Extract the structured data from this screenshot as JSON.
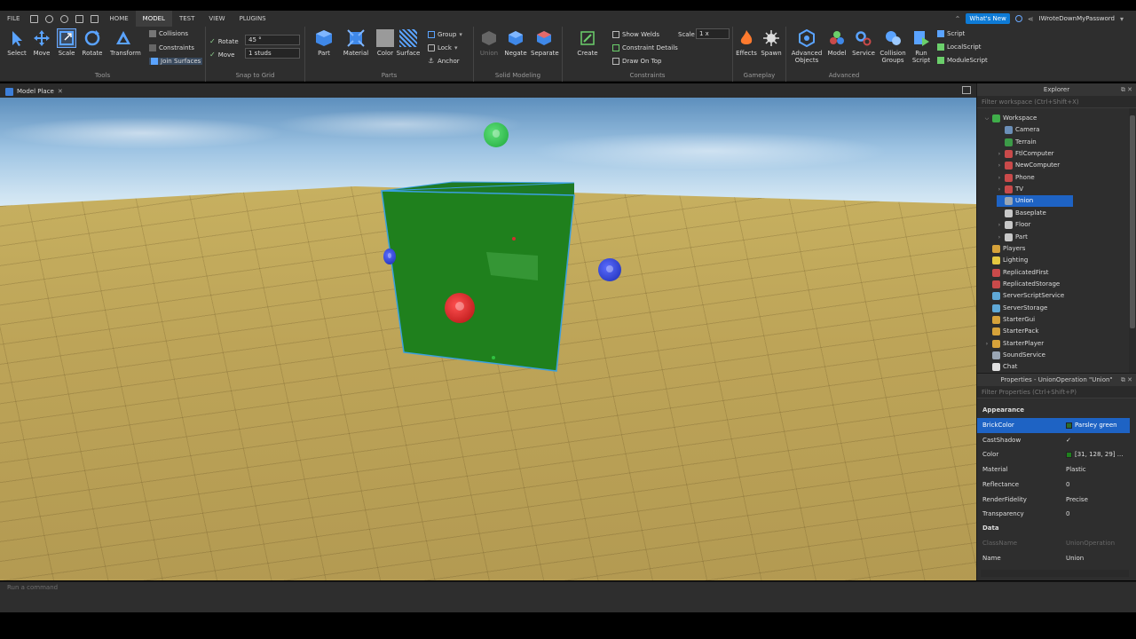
{
  "menu": {
    "items": [
      "FILE",
      "HOME",
      "MODEL",
      "TEST",
      "VIEW",
      "PLUGINS"
    ],
    "active": "MODEL",
    "whats_new": "What's New",
    "username": "IWroteDownMyPassword"
  },
  "ribbon": {
    "tools": {
      "label": "Tools",
      "items": [
        "Select",
        "Move",
        "Scale",
        "Rotate",
        "Transform"
      ],
      "options": [
        "Collisions",
        "Constraints",
        "Join Surfaces"
      ]
    },
    "snap": {
      "label": "Snap to Grid",
      "rotate_label": "Rotate",
      "rotate_value": "45 °",
      "move_label": "Move",
      "move_value": "1 studs"
    },
    "parts": {
      "label": "Parts",
      "items": [
        "Part",
        "Material",
        "Color",
        "Surface"
      ],
      "options": [
        "Group",
        "Lock",
        "Anchor"
      ]
    },
    "solid": {
      "label": "Solid Modeling",
      "items": [
        "Union",
        "Negate",
        "Separate"
      ]
    },
    "constraints": {
      "label": "Constraints",
      "create": "Create",
      "options": [
        "Show Welds",
        "Constraint Details",
        "Draw On Top"
      ],
      "scale_label": "Scale",
      "scale_value": "1 x"
    },
    "gameplay": {
      "label": "Gameplay",
      "items": [
        "Effects",
        "Spawn"
      ]
    },
    "advanced": {
      "label": "Advanced",
      "items": [
        "Advanced Objects",
        "Model",
        "Service",
        "Collision Groups",
        "Run Script"
      ],
      "scripts": [
        "Script",
        "LocalScript",
        "ModuleScript"
      ]
    }
  },
  "viewport": {
    "tab": "Model Place"
  },
  "explorer": {
    "title": "Explorer",
    "filter": "Filter workspace (Ctrl+Shift+X)",
    "items": [
      {
        "name": "Workspace",
        "level": 0,
        "expanded": true,
        "icon_color": "#3fae4a"
      },
      {
        "name": "Camera",
        "level": 1,
        "expanded": null,
        "icon_color": "#6b8fb8"
      },
      {
        "name": "Terrain",
        "level": 1,
        "expanded": null,
        "icon_color": "#3c9b48"
      },
      {
        "name": "FtlComputer",
        "level": 1,
        "expanded": false,
        "icon_color": "#c94a4a"
      },
      {
        "name": "NewComputer",
        "level": 1,
        "expanded": false,
        "icon_color": "#c94a4a"
      },
      {
        "name": "Phone",
        "level": 1,
        "expanded": false,
        "icon_color": "#c94a4a"
      },
      {
        "name": "TV",
        "level": 1,
        "expanded": false,
        "icon_color": "#c94a4a"
      },
      {
        "name": "Union",
        "level": 1,
        "expanded": null,
        "icon_color": "#9aa6b4",
        "selected": true
      },
      {
        "name": "Baseplate",
        "level": 1,
        "expanded": null,
        "icon_color": "#c8c8c8"
      },
      {
        "name": "Floor",
        "level": 1,
        "expanded": false,
        "icon_color": "#c8c8c8"
      },
      {
        "name": "Part",
        "level": 1,
        "expanded": false,
        "icon_color": "#c8c8c8"
      },
      {
        "name": "Players",
        "level": 0,
        "expanded": null,
        "icon_color": "#d6a23a"
      },
      {
        "name": "Lighting",
        "level": 0,
        "expanded": null,
        "icon_color": "#e5c840"
      },
      {
        "name": "ReplicatedFirst",
        "level": 0,
        "expanded": null,
        "icon_color": "#c94a4a"
      },
      {
        "name": "ReplicatedStorage",
        "level": 0,
        "expanded": null,
        "icon_color": "#c94a4a"
      },
      {
        "name": "ServerScriptService",
        "level": 0,
        "expanded": null,
        "icon_color": "#5fa8d6"
      },
      {
        "name": "ServerStorage",
        "level": 0,
        "expanded": null,
        "icon_color": "#5fa8d6"
      },
      {
        "name": "StarterGui",
        "level": 0,
        "expanded": null,
        "icon_color": "#d6a23a"
      },
      {
        "name": "StarterPack",
        "level": 0,
        "expanded": null,
        "icon_color": "#d6a23a"
      },
      {
        "name": "StarterPlayer",
        "level": 0,
        "expanded": false,
        "icon_color": "#d6a23a"
      },
      {
        "name": "SoundService",
        "level": 0,
        "expanded": null,
        "icon_color": "#9aa6b4"
      },
      {
        "name": "Chat",
        "level": 0,
        "expanded": null,
        "icon_color": "#e0e0e0"
      }
    ]
  },
  "properties": {
    "title": "Properties - UnionOperation \"Union\"",
    "filter": "Filter Properties (Ctrl+Shift+P)",
    "sections": [
      {
        "name": "Appearance",
        "rows": [
          {
            "name": "BrickColor",
            "value": "Parsley green",
            "swatch": "#2c6b2c",
            "selected": true
          },
          {
            "name": "CastShadow",
            "value": "✓"
          },
          {
            "name": "Color",
            "value": "[31, 128, 29] ...",
            "swatch": "#1f801d"
          },
          {
            "name": "Material",
            "value": "Plastic"
          },
          {
            "name": "Reflectance",
            "value": "0"
          },
          {
            "name": "RenderFidelity",
            "value": "Precise"
          },
          {
            "name": "Transparency",
            "value": "0"
          }
        ]
      },
      {
        "name": "Data",
        "rows": [
          {
            "name": "ClassName",
            "value": "UnionOperation",
            "dim": true
          },
          {
            "name": "Name",
            "value": "Union"
          }
        ]
      }
    ]
  },
  "command_bar": {
    "placeholder": "Run a command"
  },
  "colors": {
    "accent": "#1e63c4",
    "cube": "#1f801d",
    "selection": "#3aa0e0"
  }
}
